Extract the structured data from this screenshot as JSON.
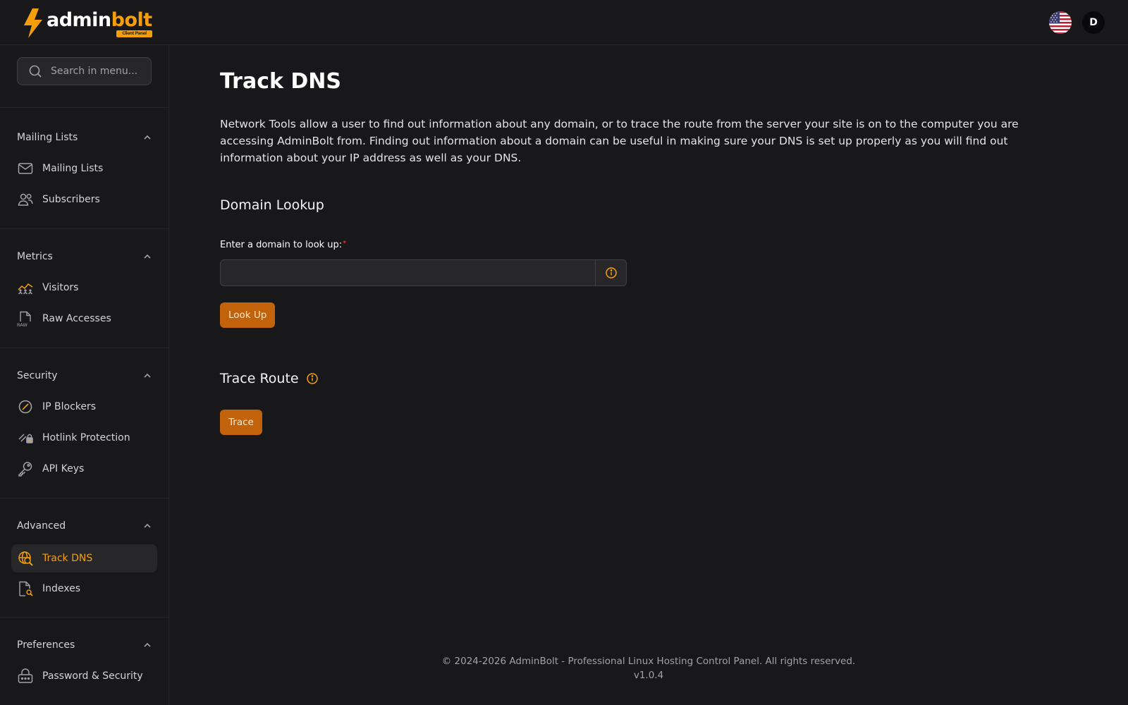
{
  "header": {
    "logo_text_1": "admin",
    "logo_text_2": "bolt",
    "logo_badge": "Client Panel",
    "avatar_initial": "D",
    "accent_color": "#f59e0b"
  },
  "sidebar": {
    "search_placeholder": "Search in menu...",
    "groups": [
      {
        "title": "Mailing Lists",
        "items": [
          {
            "label": "Mailing Lists",
            "icon": "envelope-icon"
          },
          {
            "label": "Subscribers",
            "icon": "users-icon"
          }
        ]
      },
      {
        "title": "Metrics",
        "items": [
          {
            "label": "Visitors",
            "icon": "visitors-chart-icon"
          },
          {
            "label": "Raw Accesses",
            "icon": "raw-file-icon"
          }
        ]
      },
      {
        "title": "Security",
        "items": [
          {
            "label": "IP Blockers",
            "icon": "block-icon"
          },
          {
            "label": "Hotlink Protection",
            "icon": "hotlink-lock-icon"
          },
          {
            "label": "API Keys",
            "icon": "key-icon"
          }
        ]
      },
      {
        "title": "Advanced",
        "items": [
          {
            "label": "Track DNS",
            "icon": "globe-search-icon",
            "active": true
          },
          {
            "label": "Indexes",
            "icon": "file-search-icon"
          }
        ]
      },
      {
        "title": "Preferences",
        "items": [
          {
            "label": "Password & Security",
            "icon": "password-lock-icon"
          }
        ]
      }
    ]
  },
  "main": {
    "title": "Track DNS",
    "intro": "Network Tools allow a user to find out information about any domain, or to trace the route from the server your site is on to the computer you are accessing AdminBolt from. Finding out information about a domain can be useful in making sure your DNS is set up properly as you will find out information about your IP address as well as your DNS.",
    "domain_lookup": {
      "title": "Domain Lookup",
      "label": "Enter a domain to look up:",
      "required_mark": "*",
      "value": "",
      "button": "Look Up"
    },
    "trace_route": {
      "title": "Trace Route",
      "button": "Trace"
    }
  },
  "footer": {
    "copyright": "© 2024-2026 AdminBolt - Professional Linux Hosting Control Panel. All rights reserved.",
    "version": "v1.0.4"
  }
}
